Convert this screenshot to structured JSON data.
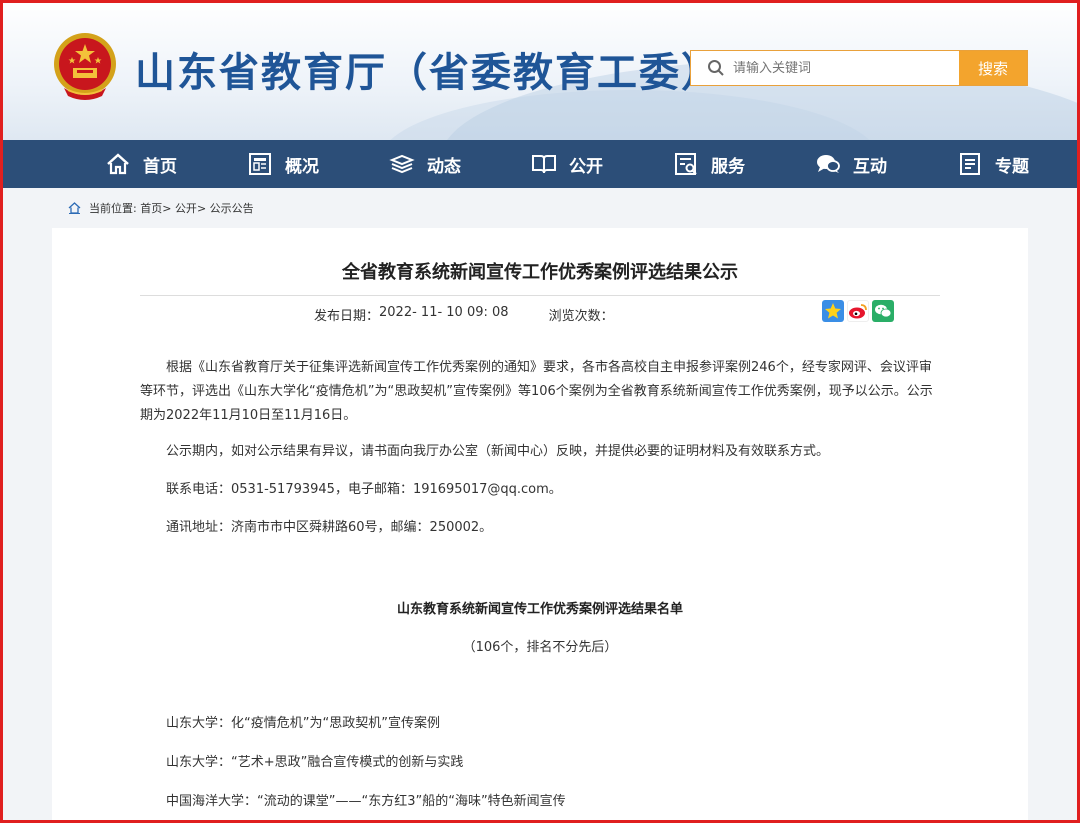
{
  "header": {
    "site_title": "山东省教育厅（省委教育工委）",
    "search_placeholder": "请输入关键词",
    "search_button": "搜索"
  },
  "nav": [
    {
      "label": "首页",
      "icon": "home-icon"
    },
    {
      "label": "概况",
      "icon": "overview-icon"
    },
    {
      "label": "动态",
      "icon": "news-icon"
    },
    {
      "label": "公开",
      "icon": "book-icon"
    },
    {
      "label": "服务",
      "icon": "service-icon"
    },
    {
      "label": "互动",
      "icon": "chat-icon"
    },
    {
      "label": "专题",
      "icon": "topic-icon"
    }
  ],
  "breadcrumb": {
    "prefix": "当前位置:",
    "items": [
      "首页",
      "公开",
      "公示公告"
    ]
  },
  "article": {
    "title": "全省教育系统新闻宣传工作优秀案例评选结果公示",
    "date_label": "发布日期：",
    "date": "2022- 11- 10 09: 08",
    "views_label": "浏览次数：",
    "paragraphs": [
      "根据《山东省教育厅关于征集评选新闻宣传工作优秀案例的通知》要求，各市各高校自主申报参评案例246个，经专家网评、会议评审等环节，评选出《山东大学化“疫情危机”为“思政契机”宣传案例》等106个案例为全省教育系统新闻宣传工作优秀案例，现予以公示。公示期为2022年11月10日至11月16日。",
      "公示期内，如对公示结果有异议，请书面向我厅办公室（新闻中心）反映，并提供必要的证明材料及有效联系方式。",
      "联系电话：0531-51793945，电子邮箱：191695017@qq.com。",
      "通讯地址：济南市市中区舜耕路60号，邮编：250002。"
    ],
    "list_title": "山东教育系统新闻宣传工作优秀案例评选结果名单",
    "list_subtitle": "（106个，排名不分先后）",
    "list_items": [
      "山东大学：化“疫情危机”为“思政契机”宣传案例",
      "山东大学：“艺术+思政”融合宣传模式的创新与实践",
      "中国海洋大学：“流动的课堂”——“东方红3”船的“海味”特色新闻宣传"
    ]
  },
  "share": [
    "qzone-icon",
    "weibo-icon",
    "wechat-icon"
  ],
  "colors": {
    "brand": "#1f5597",
    "nav": "#2c4e78",
    "accent": "#f3a42d",
    "frame": "#e01f1f"
  }
}
